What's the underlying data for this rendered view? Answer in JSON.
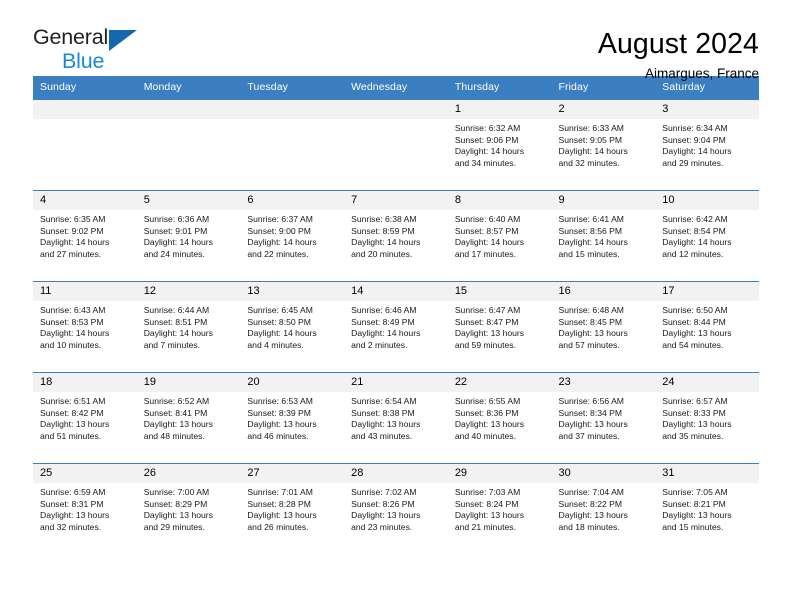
{
  "brand": {
    "name_top": "General",
    "name_bottom": "Blue",
    "triangle_color": "#1567b0",
    "blue_color": "#1b89d4"
  },
  "header": {
    "title": "August 2024",
    "subtitle": "Aimargues, France"
  },
  "theme": {
    "header_blue": "#3c7fc1",
    "daynum_bg": "#f2f2f2",
    "text": "#000000"
  },
  "calendar": {
    "weekday_headers": [
      "Sunday",
      "Monday",
      "Tuesday",
      "Wednesday",
      "Thursday",
      "Friday",
      "Saturday"
    ],
    "weeks": [
      [
        {
          "day": "",
          "sunrise": "",
          "sunset": "",
          "daylight_line1": "",
          "daylight_line2": ""
        },
        {
          "day": "",
          "sunrise": "",
          "sunset": "",
          "daylight_line1": "",
          "daylight_line2": ""
        },
        {
          "day": "",
          "sunrise": "",
          "sunset": "",
          "daylight_line1": "",
          "daylight_line2": ""
        },
        {
          "day": "",
          "sunrise": "",
          "sunset": "",
          "daylight_line1": "",
          "daylight_line2": ""
        },
        {
          "day": "1",
          "sunrise": "Sunrise: 6:32 AM",
          "sunset": "Sunset: 9:06 PM",
          "daylight_line1": "Daylight: 14 hours",
          "daylight_line2": "and 34 minutes."
        },
        {
          "day": "2",
          "sunrise": "Sunrise: 6:33 AM",
          "sunset": "Sunset: 9:05 PM",
          "daylight_line1": "Daylight: 14 hours",
          "daylight_line2": "and 32 minutes."
        },
        {
          "day": "3",
          "sunrise": "Sunrise: 6:34 AM",
          "sunset": "Sunset: 9:04 PM",
          "daylight_line1": "Daylight: 14 hours",
          "daylight_line2": "and 29 minutes."
        }
      ],
      [
        {
          "day": "4",
          "sunrise": "Sunrise: 6:35 AM",
          "sunset": "Sunset: 9:02 PM",
          "daylight_line1": "Daylight: 14 hours",
          "daylight_line2": "and 27 minutes."
        },
        {
          "day": "5",
          "sunrise": "Sunrise: 6:36 AM",
          "sunset": "Sunset: 9:01 PM",
          "daylight_line1": "Daylight: 14 hours",
          "daylight_line2": "and 24 minutes."
        },
        {
          "day": "6",
          "sunrise": "Sunrise: 6:37 AM",
          "sunset": "Sunset: 9:00 PM",
          "daylight_line1": "Daylight: 14 hours",
          "daylight_line2": "and 22 minutes."
        },
        {
          "day": "7",
          "sunrise": "Sunrise: 6:38 AM",
          "sunset": "Sunset: 8:59 PM",
          "daylight_line1": "Daylight: 14 hours",
          "daylight_line2": "and 20 minutes."
        },
        {
          "day": "8",
          "sunrise": "Sunrise: 6:40 AM",
          "sunset": "Sunset: 8:57 PM",
          "daylight_line1": "Daylight: 14 hours",
          "daylight_line2": "and 17 minutes."
        },
        {
          "day": "9",
          "sunrise": "Sunrise: 6:41 AM",
          "sunset": "Sunset: 8:56 PM",
          "daylight_line1": "Daylight: 14 hours",
          "daylight_line2": "and 15 minutes."
        },
        {
          "day": "10",
          "sunrise": "Sunrise: 6:42 AM",
          "sunset": "Sunset: 8:54 PM",
          "daylight_line1": "Daylight: 14 hours",
          "daylight_line2": "and 12 minutes."
        }
      ],
      [
        {
          "day": "11",
          "sunrise": "Sunrise: 6:43 AM",
          "sunset": "Sunset: 8:53 PM",
          "daylight_line1": "Daylight: 14 hours",
          "daylight_line2": "and 10 minutes."
        },
        {
          "day": "12",
          "sunrise": "Sunrise: 6:44 AM",
          "sunset": "Sunset: 8:51 PM",
          "daylight_line1": "Daylight: 14 hours",
          "daylight_line2": "and 7 minutes."
        },
        {
          "day": "13",
          "sunrise": "Sunrise: 6:45 AM",
          "sunset": "Sunset: 8:50 PM",
          "daylight_line1": "Daylight: 14 hours",
          "daylight_line2": "and 4 minutes."
        },
        {
          "day": "14",
          "sunrise": "Sunrise: 6:46 AM",
          "sunset": "Sunset: 8:49 PM",
          "daylight_line1": "Daylight: 14 hours",
          "daylight_line2": "and 2 minutes."
        },
        {
          "day": "15",
          "sunrise": "Sunrise: 6:47 AM",
          "sunset": "Sunset: 8:47 PM",
          "daylight_line1": "Daylight: 13 hours",
          "daylight_line2": "and 59 minutes."
        },
        {
          "day": "16",
          "sunrise": "Sunrise: 6:48 AM",
          "sunset": "Sunset: 8:45 PM",
          "daylight_line1": "Daylight: 13 hours",
          "daylight_line2": "and 57 minutes."
        },
        {
          "day": "17",
          "sunrise": "Sunrise: 6:50 AM",
          "sunset": "Sunset: 8:44 PM",
          "daylight_line1": "Daylight: 13 hours",
          "daylight_line2": "and 54 minutes."
        }
      ],
      [
        {
          "day": "18",
          "sunrise": "Sunrise: 6:51 AM",
          "sunset": "Sunset: 8:42 PM",
          "daylight_line1": "Daylight: 13 hours",
          "daylight_line2": "and 51 minutes."
        },
        {
          "day": "19",
          "sunrise": "Sunrise: 6:52 AM",
          "sunset": "Sunset: 8:41 PM",
          "daylight_line1": "Daylight: 13 hours",
          "daylight_line2": "and 48 minutes."
        },
        {
          "day": "20",
          "sunrise": "Sunrise: 6:53 AM",
          "sunset": "Sunset: 8:39 PM",
          "daylight_line1": "Daylight: 13 hours",
          "daylight_line2": "and 46 minutes."
        },
        {
          "day": "21",
          "sunrise": "Sunrise: 6:54 AM",
          "sunset": "Sunset: 8:38 PM",
          "daylight_line1": "Daylight: 13 hours",
          "daylight_line2": "and 43 minutes."
        },
        {
          "day": "22",
          "sunrise": "Sunrise: 6:55 AM",
          "sunset": "Sunset: 8:36 PM",
          "daylight_line1": "Daylight: 13 hours",
          "daylight_line2": "and 40 minutes."
        },
        {
          "day": "23",
          "sunrise": "Sunrise: 6:56 AM",
          "sunset": "Sunset: 8:34 PM",
          "daylight_line1": "Daylight: 13 hours",
          "daylight_line2": "and 37 minutes."
        },
        {
          "day": "24",
          "sunrise": "Sunrise: 6:57 AM",
          "sunset": "Sunset: 8:33 PM",
          "daylight_line1": "Daylight: 13 hours",
          "daylight_line2": "and 35 minutes."
        }
      ],
      [
        {
          "day": "25",
          "sunrise": "Sunrise: 6:59 AM",
          "sunset": "Sunset: 8:31 PM",
          "daylight_line1": "Daylight: 13 hours",
          "daylight_line2": "and 32 minutes."
        },
        {
          "day": "26",
          "sunrise": "Sunrise: 7:00 AM",
          "sunset": "Sunset: 8:29 PM",
          "daylight_line1": "Daylight: 13 hours",
          "daylight_line2": "and 29 minutes."
        },
        {
          "day": "27",
          "sunrise": "Sunrise: 7:01 AM",
          "sunset": "Sunset: 8:28 PM",
          "daylight_line1": "Daylight: 13 hours",
          "daylight_line2": "and 26 minutes."
        },
        {
          "day": "28",
          "sunrise": "Sunrise: 7:02 AM",
          "sunset": "Sunset: 8:26 PM",
          "daylight_line1": "Daylight: 13 hours",
          "daylight_line2": "and 23 minutes."
        },
        {
          "day": "29",
          "sunrise": "Sunrise: 7:03 AM",
          "sunset": "Sunset: 8:24 PM",
          "daylight_line1": "Daylight: 13 hours",
          "daylight_line2": "and 21 minutes."
        },
        {
          "day": "30",
          "sunrise": "Sunrise: 7:04 AM",
          "sunset": "Sunset: 8:22 PM",
          "daylight_line1": "Daylight: 13 hours",
          "daylight_line2": "and 18 minutes."
        },
        {
          "day": "31",
          "sunrise": "Sunrise: 7:05 AM",
          "sunset": "Sunset: 8:21 PM",
          "daylight_line1": "Daylight: 13 hours",
          "daylight_line2": "and 15 minutes."
        }
      ]
    ]
  }
}
